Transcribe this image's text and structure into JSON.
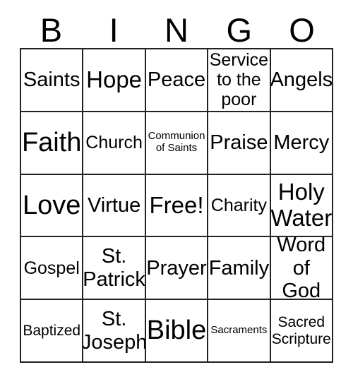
{
  "card": {
    "type": "bingo-card",
    "header": {
      "letters": [
        "B",
        "I",
        "N",
        "G",
        "O"
      ]
    },
    "grid": {
      "columns": 5,
      "rows": 5,
      "border_color": "#222222",
      "background_color": "#ffffff",
      "text_color": "#000000",
      "free_space": "Free!",
      "cells": [
        [
          {
            "text": "Saints",
            "size": "lg"
          },
          {
            "text": "Hope",
            "size": "xl"
          },
          {
            "text": "Peace",
            "size": "lg"
          },
          {
            "text": "Service\nto the\npoor",
            "size": "md"
          },
          {
            "text": "Angels",
            "size": "lg"
          }
        ],
        [
          {
            "text": "Faith",
            "size": "xxl"
          },
          {
            "text": "Church",
            "size": "md"
          },
          {
            "text": "Communion\nof Saints",
            "size": "xs"
          },
          {
            "text": "Praise",
            "size": "lg"
          },
          {
            "text": "Mercy",
            "size": "lg"
          }
        ],
        [
          {
            "text": "Love",
            "size": "xxl"
          },
          {
            "text": "Virtue",
            "size": "lg"
          },
          {
            "text": "Free!",
            "size": "xl"
          },
          {
            "text": "Charity",
            "size": "md"
          },
          {
            "text": "Holy\nWater",
            "size": "xl"
          }
        ],
        [
          {
            "text": "Gospel",
            "size": "md"
          },
          {
            "text": "St.\nPatrick",
            "size": "lg"
          },
          {
            "text": "Prayer",
            "size": "lg"
          },
          {
            "text": "Family",
            "size": "lg"
          },
          {
            "text": "Word\nof God",
            "size": "lg"
          }
        ],
        [
          {
            "text": "Baptized",
            "size": "sm"
          },
          {
            "text": "St.\nJoseph",
            "size": "lg"
          },
          {
            "text": "Bible",
            "size": "xxl"
          },
          {
            "text": "Sacraments",
            "size": "xs"
          },
          {
            "text": "Sacred\nScripture",
            "size": "sm"
          }
        ]
      ]
    }
  }
}
